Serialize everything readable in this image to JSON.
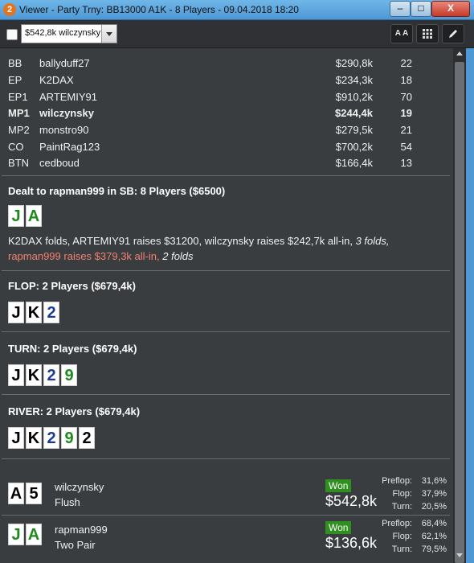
{
  "window": {
    "title": "Viewer - Party Trny: BB13000 A1K - 8 Players - 09.04.2018 18:20",
    "icon": "2",
    "minimize": "–",
    "maximize": "□",
    "close": "X"
  },
  "toolbar": {
    "combo_value": "$542,8k wilczynsky",
    "btn_text_size": "A A",
    "btn_grid": "grid-icon",
    "btn_edit": "pencil-icon"
  },
  "players": [
    {
      "pos": "BB",
      "name": "ballyduff27",
      "stack": "$290,8k",
      "bb": "22",
      "hero": false
    },
    {
      "pos": "EP",
      "name": "K2DAX",
      "stack": "$234,3k",
      "bb": "18",
      "hero": false
    },
    {
      "pos": "EP1",
      "name": "ARTEMIY91",
      "stack": "$910,2k",
      "bb": "70",
      "hero": false
    },
    {
      "pos": "MP1",
      "name": "wilczynsky",
      "stack": "$244,4k",
      "bb": "19",
      "hero": true
    },
    {
      "pos": "MP2",
      "name": "monstro90",
      "stack": "$279,5k",
      "bb": "21",
      "hero": false
    },
    {
      "pos": "CO",
      "name": "PaintRag123",
      "stack": "$700,2k",
      "bb": "54",
      "hero": false
    },
    {
      "pos": "BTN",
      "name": "cedboud",
      "stack": "$166,4k",
      "bb": "13",
      "hero": false
    }
  ],
  "preflop": {
    "header": "Dealt to rapman999 in SB: 8 Players ($6500)",
    "cards": [
      {
        "rank": "J",
        "color": "green"
      },
      {
        "rank": "A",
        "color": "green"
      }
    ],
    "action1": "K2DAX folds, ARTEMIY91 raises $31200, wilczynsky raises $242,7k all-in,",
    "action1_italic": "3 folds,",
    "action2_red": "rapman999 raises $379,3k all-in,",
    "action2_italic": "2 folds"
  },
  "flop": {
    "header": "FLOP: 2 Players ($679,4k)",
    "cards": [
      {
        "rank": "J",
        "color": "black"
      },
      {
        "rank": "K",
        "color": "black"
      },
      {
        "rank": "2",
        "color": "blue"
      }
    ]
  },
  "turn": {
    "header": "TURN: 2 Players ($679,4k)",
    "cards": [
      {
        "rank": "J",
        "color": "black"
      },
      {
        "rank": "K",
        "color": "black"
      },
      {
        "rank": "2",
        "color": "blue"
      },
      {
        "rank": "9",
        "color": "green"
      }
    ]
  },
  "river": {
    "header": "RIVER: 2 Players ($679,4k)",
    "cards": [
      {
        "rank": "J",
        "color": "black"
      },
      {
        "rank": "K",
        "color": "black"
      },
      {
        "rank": "2",
        "color": "blue"
      },
      {
        "rank": "9",
        "color": "green"
      },
      {
        "rank": "2",
        "color": "black"
      }
    ]
  },
  "results": [
    {
      "cards": [
        {
          "rank": "A",
          "color": "black"
        },
        {
          "rank": "5",
          "color": "black"
        }
      ],
      "name": "wilczynsky",
      "hand": "Flush",
      "won_label": "Won",
      "amount": "$542,8k",
      "preflop_label": "Preflop:",
      "preflop": "31,6%",
      "flop_label": "Flop:",
      "flop": "37,9%",
      "turn_label": "Turn:",
      "turn": "20,5%"
    },
    {
      "cards": [
        {
          "rank": "J",
          "color": "green"
        },
        {
          "rank": "A",
          "color": "green"
        }
      ],
      "name": "rapman999",
      "hand": "Two Pair",
      "won_label": "Won",
      "amount": "$136,6k",
      "preflop_label": "Preflop:",
      "preflop": "68,4%",
      "flop_label": "Flop:",
      "flop": "62,1%",
      "turn_label": "Turn:",
      "turn": "79,5%"
    }
  ],
  "colors": {
    "green": "#1e8a1e",
    "blue": "#1a3a9a",
    "black": "#000000",
    "accent": "#f08070",
    "won": "#2f8f1f"
  }
}
